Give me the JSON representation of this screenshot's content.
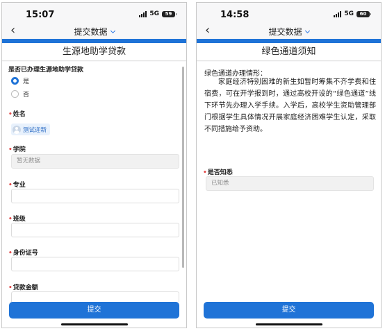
{
  "left": {
    "status_time": "15:07",
    "network": "5G",
    "battery": "59",
    "nav_title": "提交数据",
    "page_title": "生源地助学贷款",
    "question": "是否已办理生源地助学贷款",
    "options": [
      "是",
      "否"
    ],
    "selected_option": "是",
    "name_label": "姓名",
    "name_value": "测试迎新",
    "college_label": "学院",
    "college_placeholder": "暂无数据",
    "major_label": "专业",
    "class_label": "班级",
    "id_label": "身份证号",
    "amount_label": "贷款金额",
    "submit": "提交"
  },
  "right": {
    "status_time": "14:58",
    "network": "5G",
    "battery": "60",
    "nav_title": "提交数据",
    "page_title": "绿色通道须知",
    "notice_heading": "绿色通道办理情形：",
    "notice_text": "家庭经济特别困难的新生如暂时筹集不齐学费和住宿费，可在开学报到时，通过高校开设的“绿色通道”线下环节先办理入学手续。入学后，高校学生资助管理部门根据学生具体情况开展家庭经济困难学生认定，采取不同措施给予资助。",
    "ack_label": "是否知悉",
    "ack_value": "已知悉",
    "submit": "提交"
  },
  "colors": {
    "accent": "#1f73d7",
    "required": "#e24a4a",
    "chip_bg": "#e8f1fc"
  },
  "icons": [
    "back-icon",
    "chevron-down-icon",
    "signal-icon",
    "battery-icon",
    "avatar-icon"
  ]
}
